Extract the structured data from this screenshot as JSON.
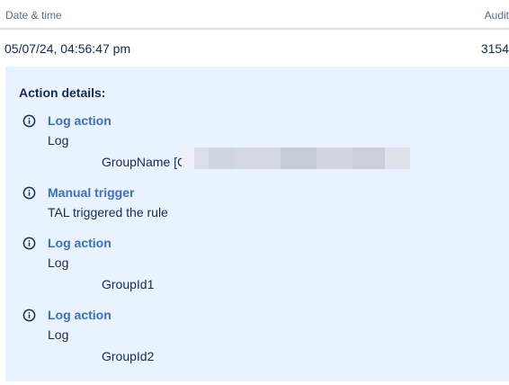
{
  "table": {
    "headers": {
      "date": "Date & time",
      "audit": "Audit"
    },
    "row": {
      "date": "05/07/24, 04:56:47 pm",
      "audit": "3154"
    }
  },
  "details": {
    "title": "Action details:",
    "actions": [
      {
        "icon": "info-icon",
        "title": "Log action",
        "subtitle": "Log",
        "detail": "GroupName [C"
      },
      {
        "icon": "info-icon",
        "title": "Manual trigger",
        "subtitle": "TAL triggered the rule",
        "detail": ""
      },
      {
        "icon": "info-icon",
        "title": "Log action",
        "subtitle": "Log",
        "detail": "GroupId1"
      },
      {
        "icon": "info-icon",
        "title": "Log action",
        "subtitle": "Log",
        "detail": "GroupId2"
      }
    ]
  },
  "colors": {
    "panel_background": "#e9f2ff",
    "link_blue": "#3b6fc1",
    "text": "#172b4d",
    "header_text": "#5e6c84"
  }
}
